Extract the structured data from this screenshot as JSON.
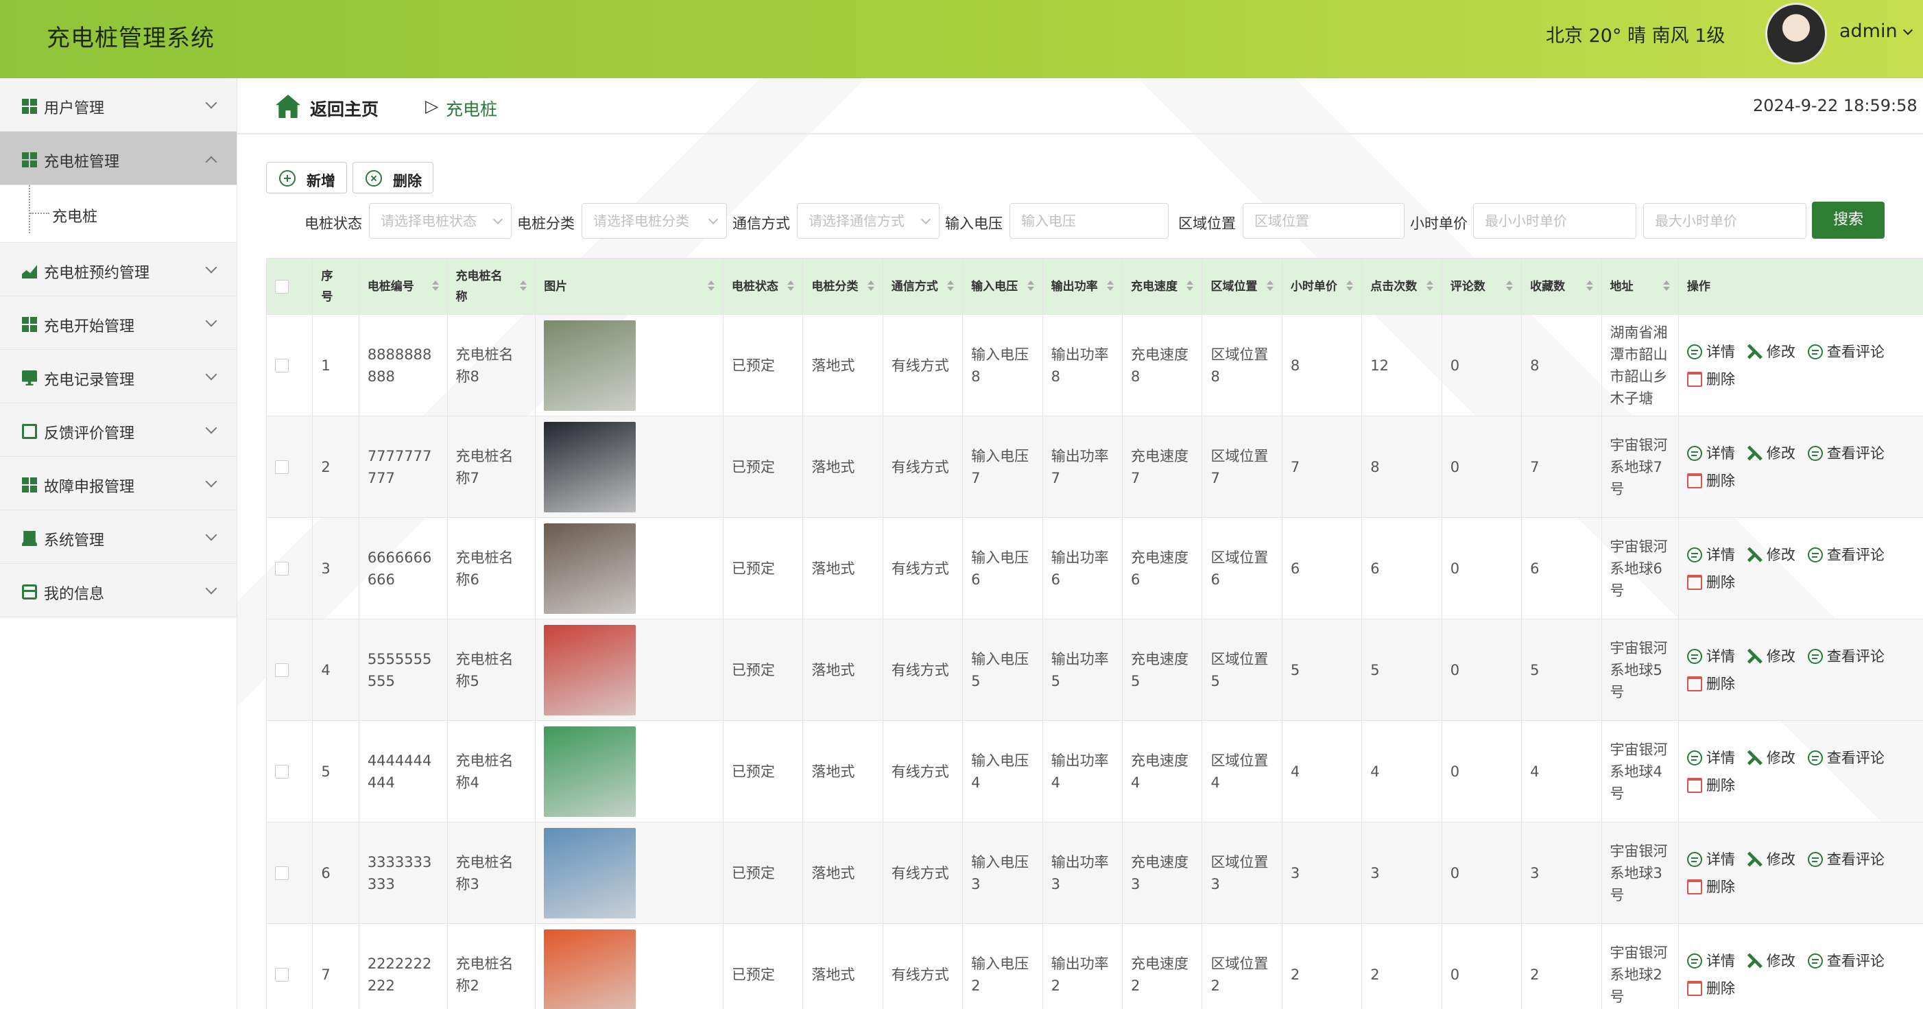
{
  "header": {
    "title": "充电桩管理系统",
    "weather": "北京 20° 晴 南风 1级",
    "user": "admin"
  },
  "sidebar": {
    "items": [
      {
        "label": "用户管理",
        "icon": "grid-icon"
      },
      {
        "label": "充电桩管理",
        "icon": "grid-icon",
        "active": true
      },
      {
        "label": "充电桩预约管理",
        "icon": "chart-icon"
      },
      {
        "label": "充电开始管理",
        "icon": "grid-icon"
      },
      {
        "label": "充电记录管理",
        "icon": "monitor-icon"
      },
      {
        "label": "反馈评价管理",
        "icon": "clipboard-icon"
      },
      {
        "label": "故障申报管理",
        "icon": "grid-icon"
      },
      {
        "label": "系统管理",
        "icon": "laptop-icon"
      },
      {
        "label": "我的信息",
        "icon": "card-icon"
      }
    ],
    "submenu": "充电桩"
  },
  "breadcrumb": {
    "home": "返回主页",
    "separator": "▷",
    "current": "充电桩"
  },
  "datetime": "2024-9-22 18:59:58",
  "toolbar": {
    "add": "新增",
    "delete": "删除"
  },
  "filters": {
    "status_label": "电桩状态",
    "status_placeholder": "请选择电桩状态",
    "category_label": "电桩分类",
    "category_placeholder": "请选择电桩分类",
    "comm_label": "通信方式",
    "comm_placeholder": "请选择通信方式",
    "voltage_label": "输入电压",
    "voltage_placeholder": "输入电压",
    "area_label": "区域位置",
    "area_placeholder": "区域位置",
    "price_label": "小时单价",
    "price_min_placeholder": "最小小时单价",
    "price_max_placeholder": "最大小时单价",
    "search": "搜索"
  },
  "table": {
    "columns": [
      "序号",
      "电桩编号",
      "充电桩名称",
      "图片",
      "电桩状态",
      "电桩分类",
      "通信方式",
      "输入电压",
      "输出功率",
      "充电速度",
      "区域位置",
      "小时单价",
      "点击次数",
      "评论数",
      "收藏数",
      "地址",
      "操作"
    ],
    "actions": {
      "detail": "详情",
      "edit": "修改",
      "comments": "查看评论",
      "delete": "删除"
    },
    "rows": [
      {
        "idx": "1",
        "code": "8888888888",
        "name": "充电桩名称8",
        "status": "已预定",
        "category": "落地式",
        "comm": "有线方式",
        "voltage": "输入电压8",
        "power": "输出功率8",
        "speed": "充电速度8",
        "area": "区域位置8",
        "price": "8",
        "clicks": "12",
        "comments": "0",
        "favs": "8",
        "address": "湖南省湘潭市韶山市韶山乡木子塘",
        "thumb": "#7a8a6a"
      },
      {
        "idx": "2",
        "code": "7777777777",
        "name": "充电桩名称7",
        "status": "已预定",
        "category": "落地式",
        "comm": "有线方式",
        "voltage": "输入电压7",
        "power": "输出功率7",
        "speed": "充电速度7",
        "area": "区域位置7",
        "price": "7",
        "clicks": "8",
        "comments": "0",
        "favs": "7",
        "address": "宇宙银河系地球7号",
        "thumb": "#23272e"
      },
      {
        "idx": "3",
        "code": "6666666666",
        "name": "充电桩名称6",
        "status": "已预定",
        "category": "落地式",
        "comm": "有线方式",
        "voltage": "输入电压6",
        "power": "输出功率6",
        "speed": "充电速度6",
        "area": "区域位置6",
        "price": "6",
        "clicks": "6",
        "comments": "0",
        "favs": "6",
        "address": "宇宙银河系地球6号",
        "thumb": "#6a5a4e"
      },
      {
        "idx": "4",
        "code": "5555555555",
        "name": "充电桩名称5",
        "status": "已预定",
        "category": "落地式",
        "comm": "有线方式",
        "voltage": "输入电压5",
        "power": "输出功率5",
        "speed": "充电速度5",
        "area": "区域位置5",
        "price": "5",
        "clicks": "5",
        "comments": "0",
        "favs": "5",
        "address": "宇宙银河系地球5号",
        "thumb": "#c9433a"
      },
      {
        "idx": "5",
        "code": "4444444444",
        "name": "充电桩名称4",
        "status": "已预定",
        "category": "落地式",
        "comm": "有线方式",
        "voltage": "输入电压4",
        "power": "输出功率4",
        "speed": "充电速度4",
        "area": "区域位置4",
        "price": "4",
        "clicks": "4",
        "comments": "0",
        "favs": "4",
        "address": "宇宙银河系地球4号",
        "thumb": "#3f9a5a"
      },
      {
        "idx": "6",
        "code": "3333333333",
        "name": "充电桩名称3",
        "status": "已预定",
        "category": "落地式",
        "comm": "有线方式",
        "voltage": "输入电压3",
        "power": "输出功率3",
        "speed": "充电速度3",
        "area": "区域位置3",
        "price": "3",
        "clicks": "3",
        "comments": "0",
        "favs": "3",
        "address": "宇宙银河系地球3号",
        "thumb": "#5f8fb8"
      },
      {
        "idx": "7",
        "code": "2222222222",
        "name": "充电桩名称2",
        "status": "已预定",
        "category": "落地式",
        "comm": "有线方式",
        "voltage": "输入电压2",
        "power": "输出功率2",
        "speed": "充电速度2",
        "area": "区域位置2",
        "price": "2",
        "clicks": "2",
        "comments": "0",
        "favs": "2",
        "address": "宇宙银河系地球2号",
        "thumb": "#e2582a"
      }
    ]
  }
}
